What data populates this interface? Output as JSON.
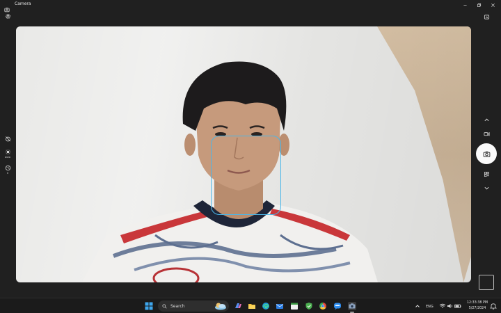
{
  "window": {
    "title": "Camera"
  },
  "left_rail": {
    "hdr_label": "auto",
    "color_label": "0"
  },
  "taskbar": {
    "search_label": "Search",
    "language": "ENG",
    "time": "12:33:38 PM",
    "date": "5/27/2024"
  },
  "colors": {
    "face_box": "#4bb6e8",
    "taskbar_bg": "#1b1b1b",
    "app_bg": "#202020"
  }
}
